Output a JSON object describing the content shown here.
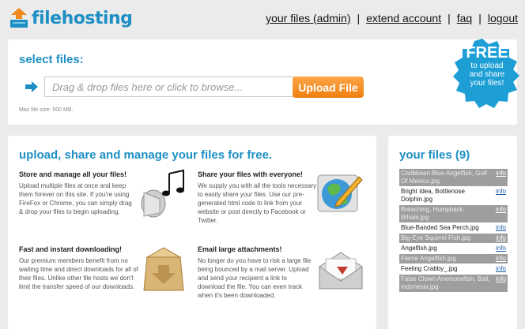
{
  "brand": {
    "name": "filehosting",
    "accent": "#1d8fc4",
    "icon": "upload-box-icon"
  },
  "nav": {
    "your_files": "your files (admin)",
    "extend_account": "extend account",
    "faq": "faq",
    "logout": "logout",
    "separator": "|"
  },
  "upload": {
    "title": "select files:",
    "placeholder": "Drag & drop files here or click to browse...",
    "button": "Upload File",
    "max_size": "Max file size: 500 MB.",
    "arrow_icon": "arrow-right-icon"
  },
  "promo": {
    "big": "FREE",
    "line1": "to upload",
    "line2": "and share",
    "line3": "your files!"
  },
  "main": {
    "title": "upload, share and manage your files for free.",
    "features": [
      {
        "heading": "Store and manage all your files!",
        "body": "Upload multiple files at once and keep them forever on this site. If you're using FireFox or Chrome, you can simply drag & drop your files to begin uploading.",
        "icon": "music-speaker-icon"
      },
      {
        "heading": "Share your files with everyone!",
        "body": "We supply you with all the tools necessary to easily share your files. Use our pre-generated html code to link from your website or post directly to Facebook or Twitter.",
        "icon": "globe-pencil-icon"
      },
      {
        "heading": "Fast and instant downloading!",
        "body": "Our premium members benefit from no waiting time and direct downloads for all of their files. Unlike other file hosts we don't limit the transfer speed of our downloads.",
        "icon": "download-box-icon"
      },
      {
        "heading": "Email large attachments!",
        "body": "No longer do you have to risk a large file being bounced by a mail server. Upload and send your recipient a link to download the file. You can even track when it's been downloaded.",
        "icon": "envelope-icon"
      }
    ]
  },
  "files": {
    "title": "your files (9)",
    "info_label": "info",
    "items": [
      {
        "name": "Caribbean Blue Angelfish, Gulf Of Mexico.jpg"
      },
      {
        "name": "Bright Idea, Bottlenose Dolphin.jpg"
      },
      {
        "name": "Breaching, Humpback Whale.jpg"
      },
      {
        "name": "Blue-Banded Sea Perch.jpg"
      },
      {
        "name": "Big-Eye Squirrel Fish.jpg"
      },
      {
        "name": "Angelfish.jpg"
      },
      {
        "name": "Flame Angelfish.jpg"
      },
      {
        "name": "Feeling Crabby_.jpg"
      },
      {
        "name": "False Clown Anemonefish, Bali, Indonesia.jpg"
      }
    ]
  }
}
